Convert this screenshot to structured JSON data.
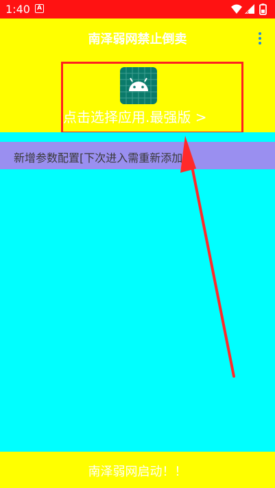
{
  "status_bar": {
    "time": "1:40",
    "notification_badge": "A",
    "icons": [
      "wifi-icon",
      "signal-icon",
      "battery-icon"
    ]
  },
  "app_bar": {
    "title": "南泽弱网禁止倒卖",
    "overflow_icon": "more-vert-icon"
  },
  "app_picker": {
    "icon": "android-icon",
    "label": "点击选择应用.最强版 >"
  },
  "config": {
    "label": "新增参数配置[下次进入需重新添加]"
  },
  "start_button": {
    "label": "南泽弱网启动！！"
  },
  "colors": {
    "status_bar": "#ff1212",
    "app_bar": "#ffff00",
    "content_bg": "#00ffff",
    "config_bar": "#9a8ff0",
    "highlight_border": "#ff2020",
    "annotation_arrow": "#ff2a2a",
    "android_icon_bg": "#0a7a6a"
  }
}
